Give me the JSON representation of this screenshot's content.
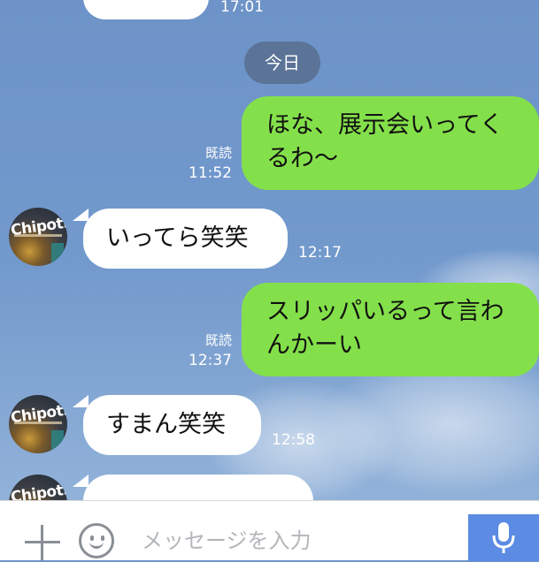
{
  "colors": {
    "outgoing_bubble": "#84e04a",
    "incoming_bubble": "#ffffff",
    "send_button": "#5b8be2"
  },
  "date_separator": "今日",
  "messages": [
    {
      "direction": "incoming",
      "text_partial": true,
      "time": "17:01"
    },
    {
      "direction": "outgoing",
      "lines": [
        "ほな、展示会いってく",
        "るわ〜"
      ],
      "read": "既読",
      "time": "11:52"
    },
    {
      "direction": "incoming",
      "text": "いってら笑笑",
      "time": "12:17",
      "avatar": "Chipotle"
    },
    {
      "direction": "outgoing",
      "lines": [
        "スリッパいるって言わ",
        "んかーい"
      ],
      "read": "既読",
      "time": "12:37"
    },
    {
      "direction": "incoming",
      "text": "すまん笑笑",
      "time": "12:58",
      "avatar": "Chipotle"
    },
    {
      "direction": "incoming",
      "text_partial": true,
      "avatar": "Chipotle"
    }
  ],
  "input": {
    "placeholder": "メッセージを入力",
    "value": ""
  },
  "icons": {
    "add": "plus-icon",
    "emoji": "emoji-icon",
    "voice": "microphone-icon"
  }
}
